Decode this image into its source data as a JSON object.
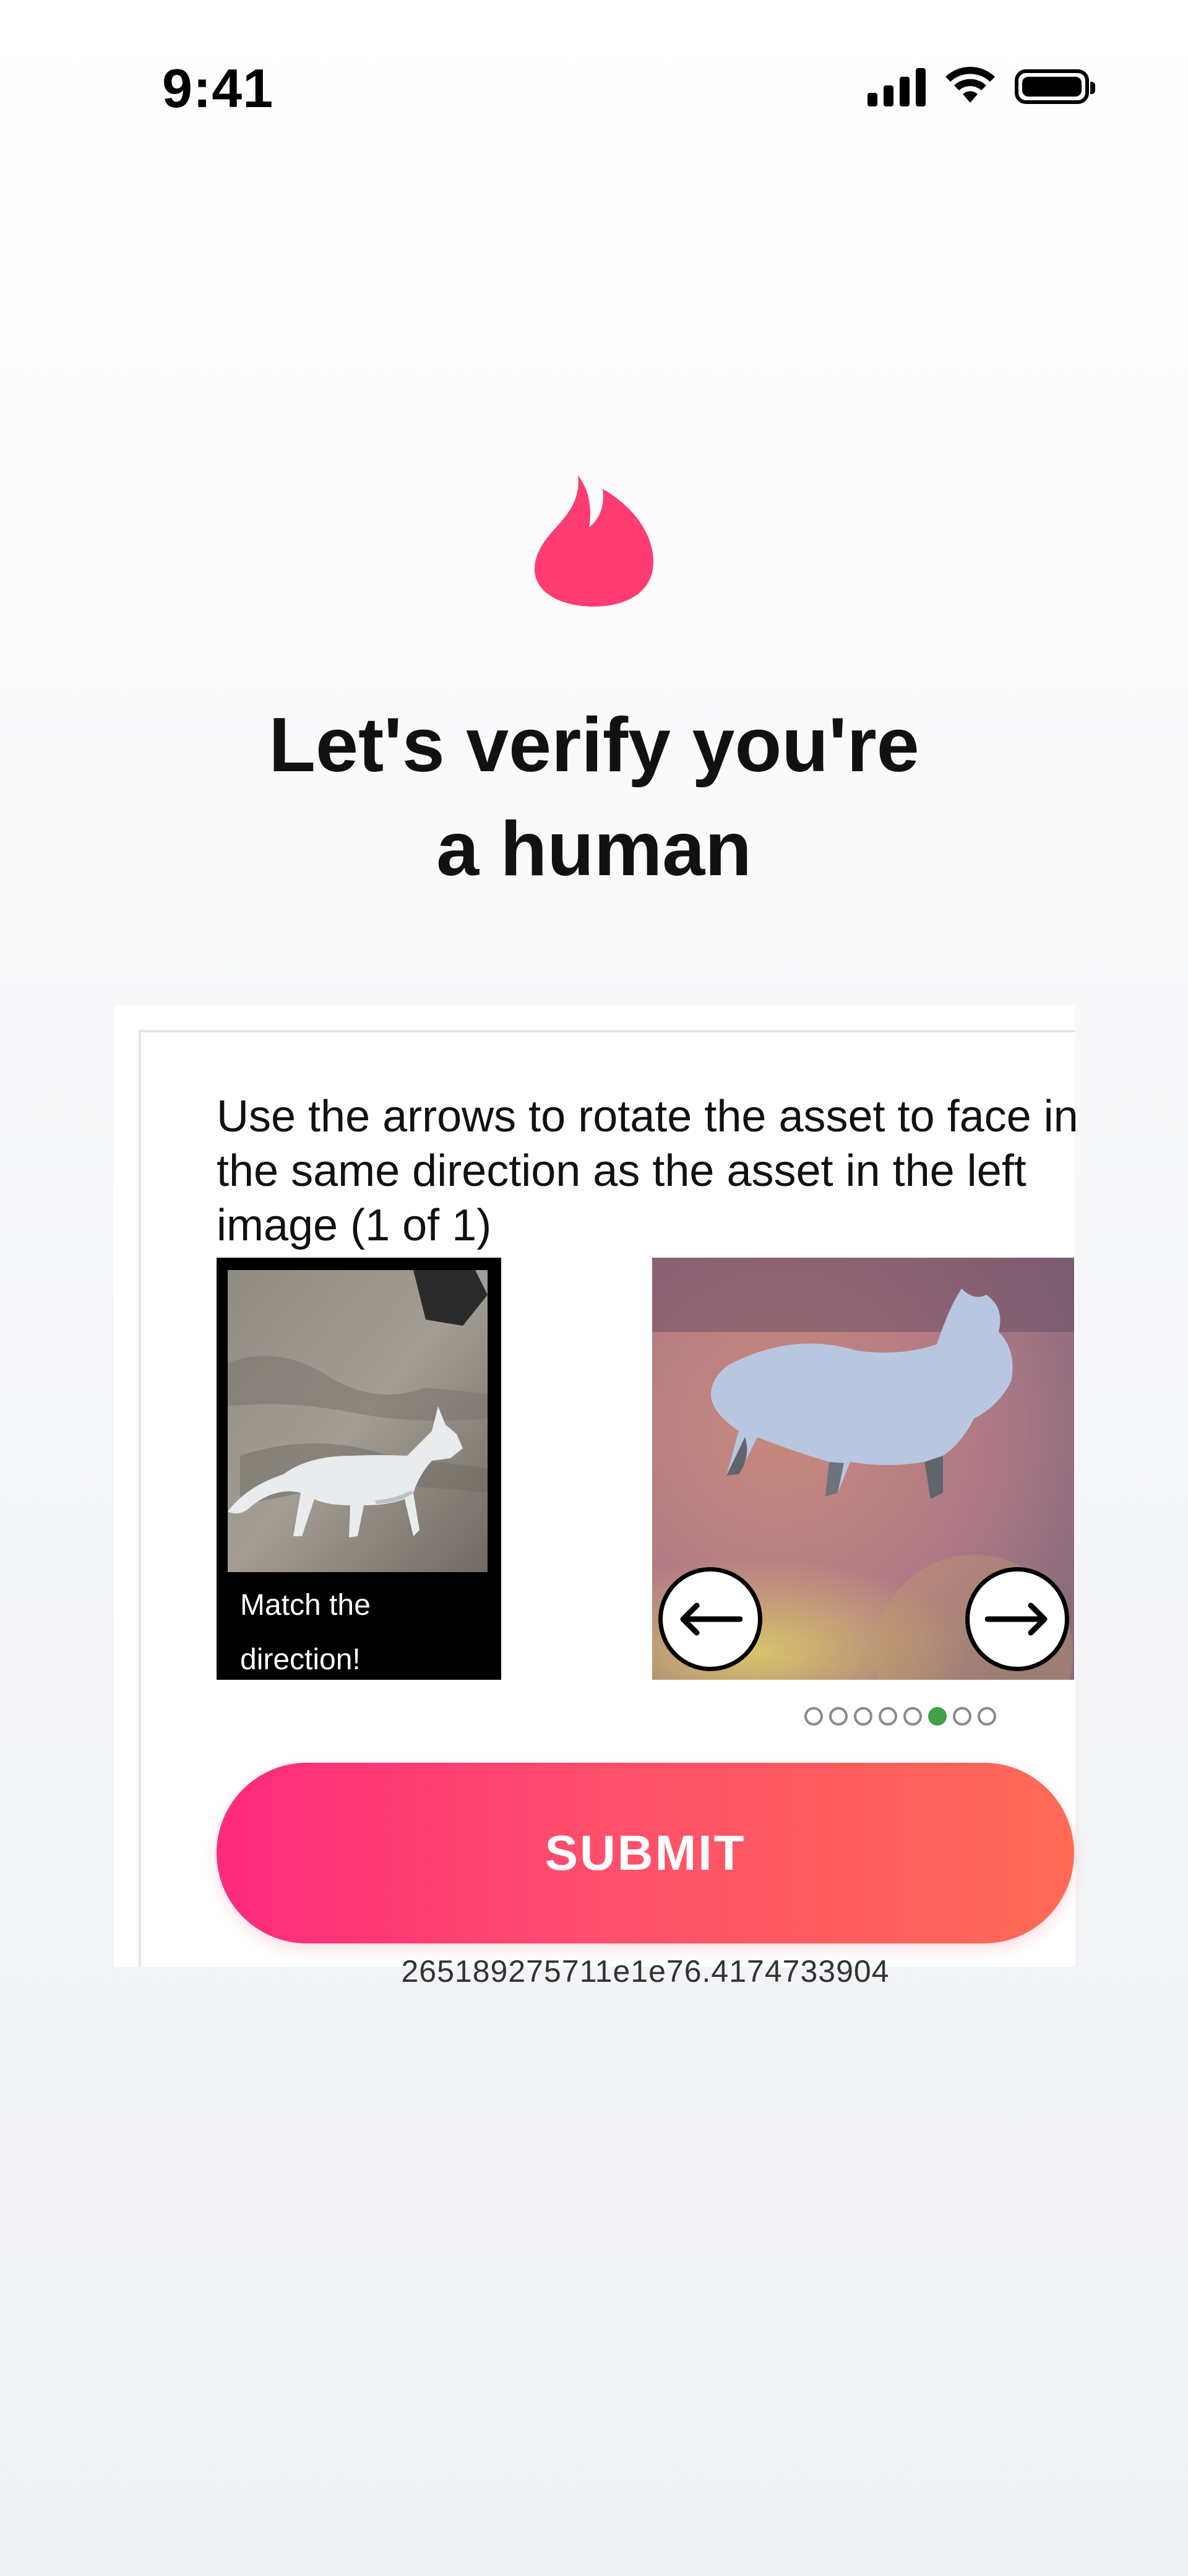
{
  "status_bar": {
    "time": "9:41"
  },
  "colors": {
    "brand": "#fd2a7c",
    "brand_end": "#ff6b55",
    "active_dot": "#3fa24a"
  },
  "icons": {
    "logo": "flame-logo-icon",
    "signal": "cellular-signal-icon",
    "wifi": "wifi-icon",
    "battery": "battery-icon",
    "left_arrow": "arrow-left-icon",
    "right_arrow": "arrow-right-icon"
  },
  "header": {
    "title_line1": "Let's verify you're",
    "title_line2": "a human"
  },
  "challenge": {
    "instruction": "Use the arrows to rotate the asset to face in the same direction as the asset in the left image (1 of 1)",
    "reference_caption_line1": "Match the",
    "reference_caption_line2": "direction!",
    "dots_total": 8,
    "dots_active_index": 5,
    "submit_label": "SUBMIT",
    "session_id": "265189275711e1e76.4174733904"
  }
}
